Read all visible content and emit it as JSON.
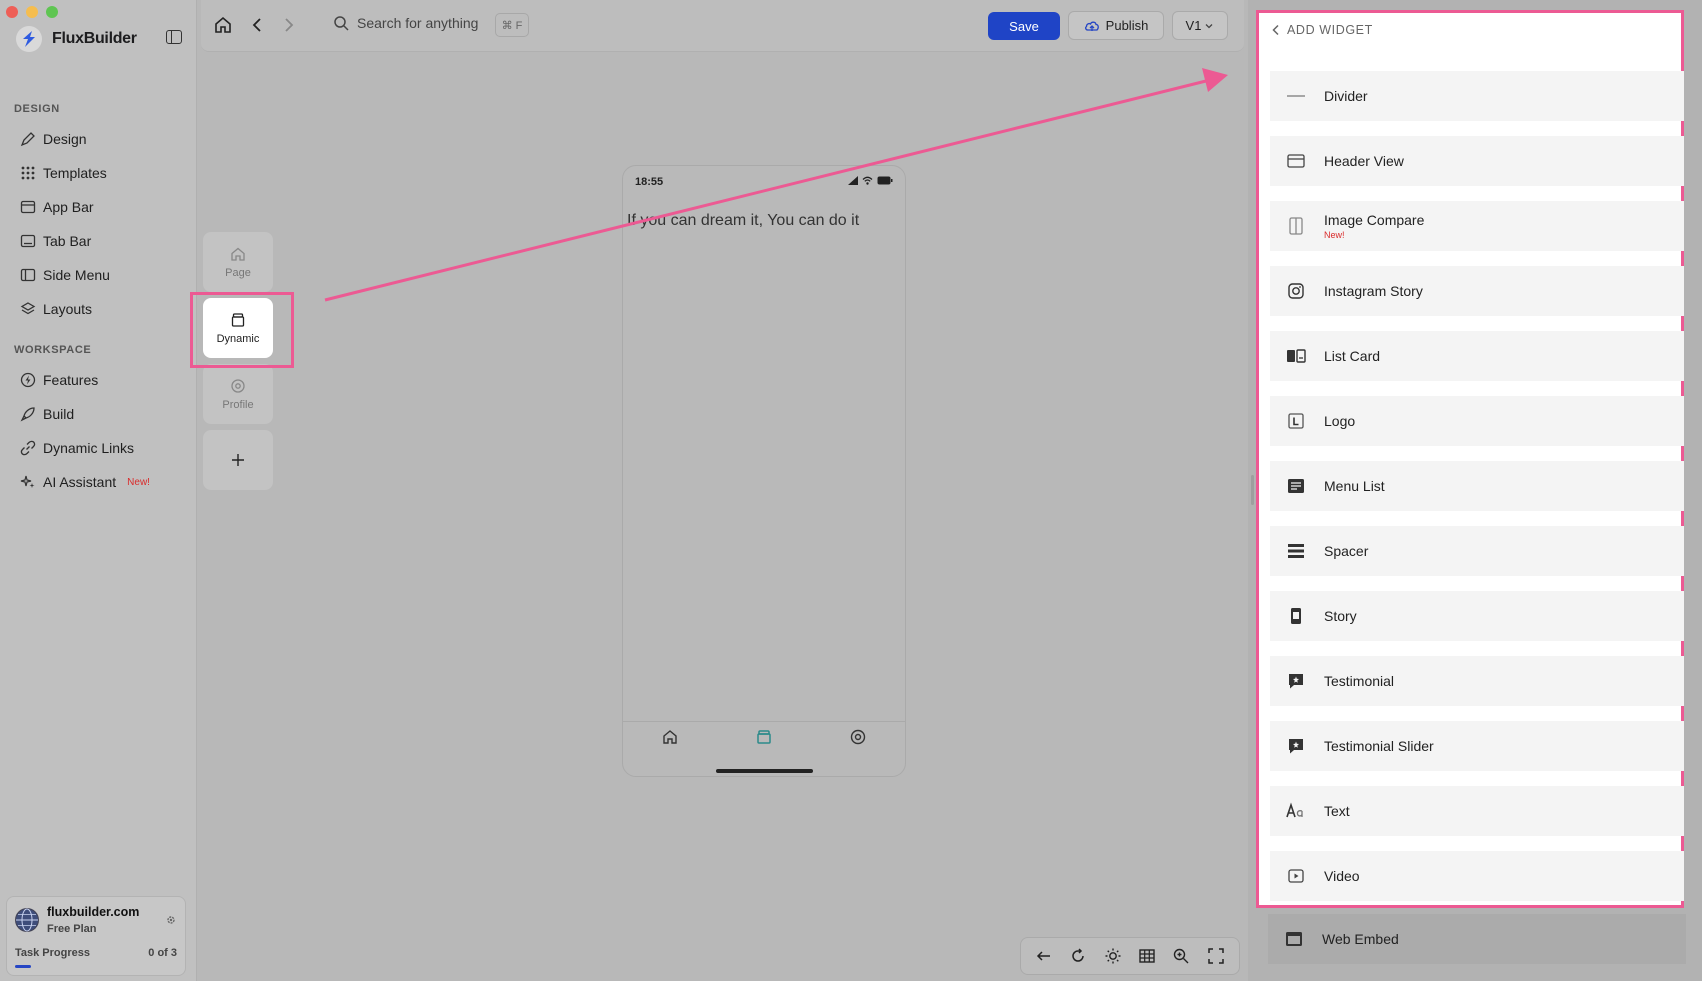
{
  "app": {
    "name": "FluxBuilder"
  },
  "sidebar": {
    "design_label": "DESIGN",
    "design_items": [
      {
        "label": "Design",
        "icon": "pen-icon"
      },
      {
        "label": "Templates",
        "icon": "grid-icon"
      },
      {
        "label": "App Bar",
        "icon": "app-bar-icon"
      },
      {
        "label": "Tab Bar",
        "icon": "tab-bar-icon"
      },
      {
        "label": "Side Menu",
        "icon": "side-menu-icon"
      },
      {
        "label": "Layouts",
        "icon": "layers-icon"
      }
    ],
    "workspace_label": "WORKSPACE",
    "workspace_items": [
      {
        "label": "Features",
        "icon": "bolt-icon"
      },
      {
        "label": "Build",
        "icon": "rocket-icon"
      },
      {
        "label": "Dynamic Links",
        "icon": "link-icon"
      },
      {
        "label": "AI Assistant",
        "icon": "sparkle-icon",
        "badge": "New!"
      }
    ],
    "account": {
      "domain": "fluxbuilder.com",
      "plan": "Free Plan",
      "task_label": "Task Progress",
      "task_count": "0 of 3",
      "task_progress": 0.1
    }
  },
  "topbar": {
    "search_placeholder": "Search for anything",
    "shortcut": "⌘ F",
    "save_label": "Save",
    "publish_label": "Publish",
    "version_label": "V1"
  },
  "pages": [
    {
      "label": "Page",
      "icon": "home-icon",
      "active": false
    },
    {
      "label": "Dynamic",
      "icon": "box-icon",
      "active": true
    },
    {
      "label": "Profile",
      "icon": "profile-icon",
      "active": false
    }
  ],
  "phone": {
    "time": "18:55",
    "quote": "If you can dream it, You can do it"
  },
  "panel": {
    "title": "ADD WIDGET",
    "widgets": [
      {
        "label": "Divider",
        "icon": "divider-icon"
      },
      {
        "label": "Header View",
        "icon": "header-view-icon"
      },
      {
        "label": "Image Compare",
        "icon": "image-compare-icon",
        "badge": "New!"
      },
      {
        "label": "Instagram Story",
        "icon": "instagram-icon"
      },
      {
        "label": "List Card",
        "icon": "list-card-icon"
      },
      {
        "label": "Logo",
        "icon": "logo-icon"
      },
      {
        "label": "Menu List",
        "icon": "menu-list-icon"
      },
      {
        "label": "Spacer",
        "icon": "spacer-icon"
      },
      {
        "label": "Story",
        "icon": "story-icon"
      },
      {
        "label": "Testimonial",
        "icon": "testimonial-icon"
      },
      {
        "label": "Testimonial Slider",
        "icon": "testimonial-slider-icon"
      },
      {
        "label": "Text",
        "icon": "text-icon"
      },
      {
        "label": "Video",
        "icon": "video-icon"
      }
    ],
    "extra_widget": {
      "label": "Web Embed",
      "icon": "web-embed-icon"
    }
  },
  "colors": {
    "accent": "#1f44c6",
    "highlight": "#ec5a93",
    "new_badge": "#d92c2c"
  }
}
